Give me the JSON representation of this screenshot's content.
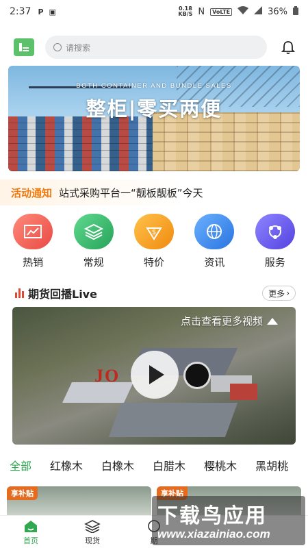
{
  "status_bar": {
    "time": "2:37",
    "net_speed": "0.18",
    "net_unit": "KB/S",
    "volte": "VoLTE",
    "battery": "36%"
  },
  "header": {
    "search_placeholder": "请搜索"
  },
  "banner": {
    "subtitle": "BOTH CONTAINER AND BUNDLE SALES",
    "title": "整柜|零买两便"
  },
  "notice": {
    "tag": "活动通知",
    "text": "站式采购平台一“靓板靓板”今天"
  },
  "categories": [
    {
      "label": "热销",
      "icon": "chart-icon",
      "color": "#f0605a"
    },
    {
      "label": "常规",
      "icon": "layers-icon",
      "color": "#38b870"
    },
    {
      "label": "特价",
      "icon": "price-tag-icon",
      "color": "#f5a623"
    },
    {
      "label": "资讯",
      "icon": "globe-icon",
      "color": "#3b8ff0"
    },
    {
      "label": "服务",
      "icon": "share-icon",
      "color": "#6a5cf0"
    }
  ],
  "futures": {
    "title": "期货回播Live",
    "more": "更多",
    "video_cta": "点击查看更多视频",
    "brand": "JO"
  },
  "tabs": [
    "全部",
    "红橡木",
    "白橡木",
    "白腊木",
    "樱桃木",
    "黑胡桃"
  ],
  "cards": [
    {
      "badge": "享补贴"
    },
    {
      "badge": "享补贴"
    }
  ],
  "bottom_nav": [
    {
      "label": "首页",
      "icon": "home-icon"
    },
    {
      "label": "现货",
      "icon": "stack-icon"
    },
    {
      "label": "期",
      "icon": "clock-icon"
    }
  ],
  "watermark": {
    "line1": "下载鸟应用",
    "line2": "www.xiazainiao.com"
  },
  "colors": {
    "accent": "#2fa84f",
    "notice": "#f07a10",
    "live_bars": "#e04a35"
  }
}
